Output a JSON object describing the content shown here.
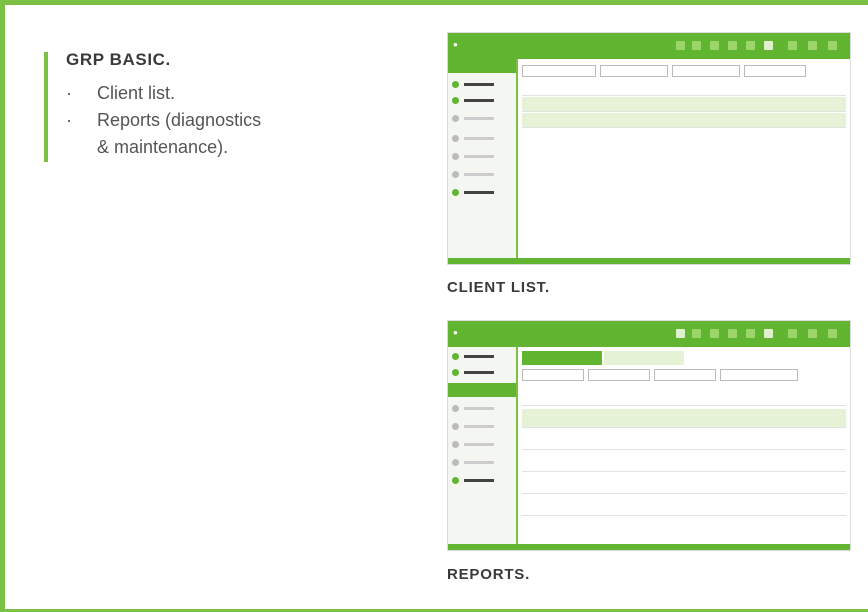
{
  "left": {
    "title": "GRP BASIC.",
    "bullets": [
      "Client list.",
      "Reports (diagnostics",
      "& maintenance)."
    ],
    "bullet_symbol": "·"
  },
  "captions": {
    "client_list": "CLIENT LIST.",
    "reports": "REPORTS."
  },
  "colors": {
    "accent": "#7cc143",
    "app_green": "#62b531"
  }
}
